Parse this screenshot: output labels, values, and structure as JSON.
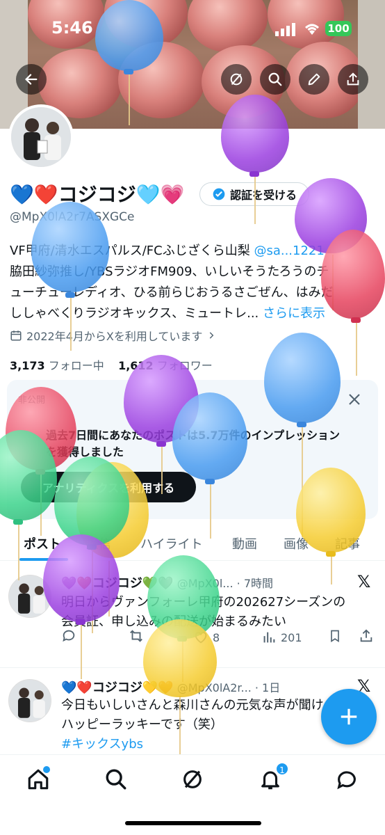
{
  "status_bar": {
    "time": "5:46",
    "battery": "100"
  },
  "profile": {
    "display_name": "💙❤️コジコジ🩵💗",
    "handle": "@MpX0lA2r7ASXGCe",
    "verify_label": "認証を受ける",
    "bio_lines": [
      {
        "pre": "VF甲府/清水エスパルス/FCふじざくら山梨 ",
        "link": "@sa...1221"
      },
      {
        "pre": "脇田紗弥推し/YBSラジオFM909、いしいそうたろうのチ",
        "link": ""
      },
      {
        "pre": "ューチューレディオ、ひる前らじおうるさごぜん、はみだ",
        "link": ""
      },
      {
        "pre": "ししゃべくりラジオキックス、ミュートレ... ",
        "link": "さらに表示"
      }
    ],
    "joined": "2022年4月からXを利用しています",
    "following_count": "3,173",
    "following_label": "フォロー中",
    "followers_count": "1,612",
    "followers_label": "フォロワー"
  },
  "analytics_card": {
    "private_label": "非公開",
    "text_line1": "過去7日間にあなたのポストは5.7万件のインプレッション",
    "text_line2": "を獲得しました",
    "button_label": "アナリティクスを利用する"
  },
  "tabs": [
    {
      "label": "ポスト"
    },
    {
      "label": "返信"
    },
    {
      "label": "ハイライト"
    },
    {
      "label": "動画"
    },
    {
      "label": "画像"
    },
    {
      "label": "記事"
    }
  ],
  "tweets": [
    {
      "name": "💜❤️コジコジ💚🩶",
      "meta": "@MpX0l... · 7時間",
      "text_line1": "明日からヴァンフォーレ甲府の202627シーズンの",
      "text_line2": "会員証、申し込みの配送が始まるみたい",
      "likes": "8",
      "views": "201"
    },
    {
      "name": "💙❤️コジコジ💛🧡",
      "meta": "@MpX0lA2r... · 1日",
      "text_line1": "今日もいしいさんと森川さんの元気な声が聞け",
      "text_line2": "ハッピーラッキーです（笑）",
      "hashtag": "#キックスybs"
    }
  ],
  "nav": {
    "notifications_badge": "1"
  },
  "colors": {
    "accent": "#1d9bf0",
    "text": "#0f1419",
    "muted": "#536471"
  }
}
